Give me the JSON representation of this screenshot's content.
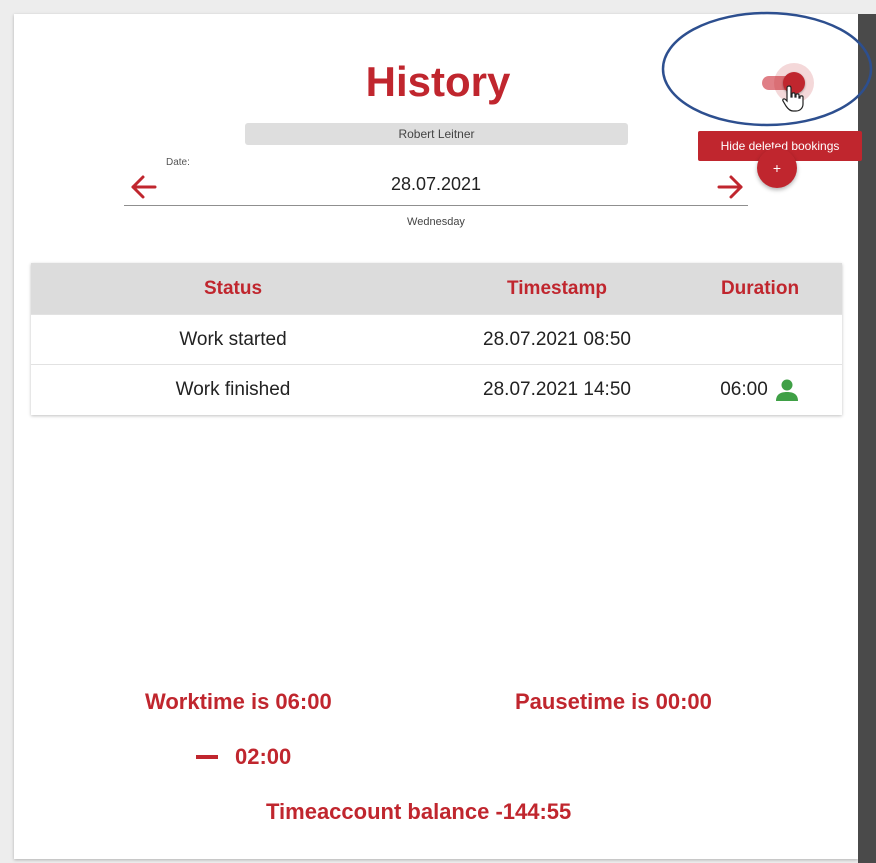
{
  "page": {
    "title": "History",
    "user_name": "Robert Leitner"
  },
  "date_picker": {
    "label": "Date:",
    "value": "28.07.2021",
    "weekday": "Wednesday",
    "prev_icon": "arrow-left-icon",
    "next_icon": "arrow-right-icon"
  },
  "toggle": {
    "name": "hide-deleted-toggle",
    "on": true,
    "tooltip": "Hide deleted bookings"
  },
  "fab": {
    "label": "+"
  },
  "table": {
    "headers": [
      "Status",
      "Timestamp",
      "Duration"
    ],
    "rows": [
      {
        "status": "Work started",
        "timestamp": "28.07.2021 08:50",
        "duration": ""
      },
      {
        "status": "Work finished",
        "timestamp": "28.07.2021 14:50",
        "duration": "06:00",
        "duration_icon": "person-icon"
      }
    ]
  },
  "summary": {
    "worktime": "Worktime is 06:00",
    "pausetime": "Pausetime is 00:00",
    "difference": "02:00",
    "balance": "Timeaccount balance -144:55"
  },
  "colors": {
    "accent": "#c0262e",
    "accent_light": "#e07f86",
    "header_bg": "#dcdcdc",
    "success": "#3fa046",
    "highlight_ring": "#2d4f8f"
  }
}
